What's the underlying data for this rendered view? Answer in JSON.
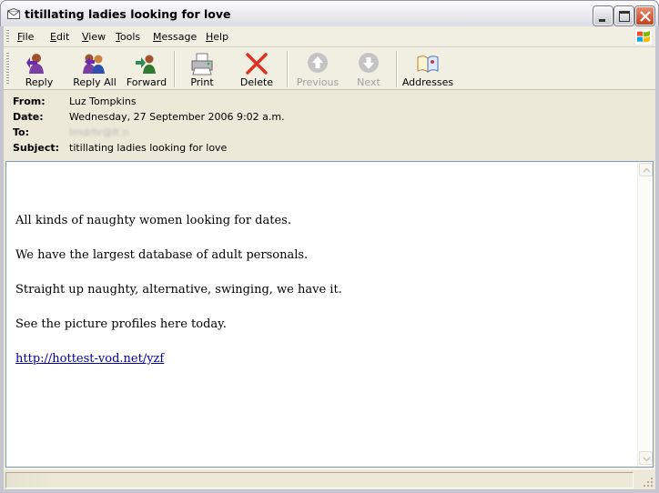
{
  "window": {
    "title": "titillating ladies looking for love",
    "controls": [
      "minimize",
      "maximize",
      "close"
    ]
  },
  "menu": [
    {
      "pre": "",
      "u": "F",
      "post": "ile"
    },
    {
      "pre": "",
      "u": "E",
      "post": "dit"
    },
    {
      "pre": "",
      "u": "V",
      "post": "iew"
    },
    {
      "pre": "",
      "u": "T",
      "post": "ools"
    },
    {
      "pre": "",
      "u": "M",
      "post": "essage"
    },
    {
      "pre": "",
      "u": "H",
      "post": "elp"
    }
  ],
  "toolbar": {
    "reply": "Reply",
    "reply_all": "Reply All",
    "forward": "Forward",
    "print": "Print",
    "delete": "Delete",
    "previous": "Previous",
    "next": "Next",
    "addresses": "Addresses"
  },
  "header": {
    "from_label": "From:",
    "from": "Luz Tompkins",
    "date_label": "Date:",
    "date": "Wednesday, 27 September 2006 9:02 a.m.",
    "to_label": "To:",
    "to": "lmdrhr@lt.n",
    "subject_label": "Subject:",
    "subject": "titillating ladies looking for love"
  },
  "body": {
    "lines": [
      "All kinds of naughty women looking for dates.",
      "We have the largest database of adult personals.",
      "Straight up naughty, alternative, swinging, we have it.",
      "See the picture profiles here today."
    ],
    "link": "http://hottest-vod.net/yzf"
  },
  "icons": {
    "reply": "reply-icon",
    "reply_all": "reply-all-icon",
    "forward": "forward-icon",
    "print": "printer-icon",
    "delete": "delete-x-icon",
    "previous": "up-arrow-icon",
    "next": "down-arrow-icon",
    "addresses": "address-book-icon"
  },
  "colors": {
    "delete_red": "#e0301e",
    "link_blue": "#00009c",
    "disabled_gray": "#a0a0a0"
  }
}
